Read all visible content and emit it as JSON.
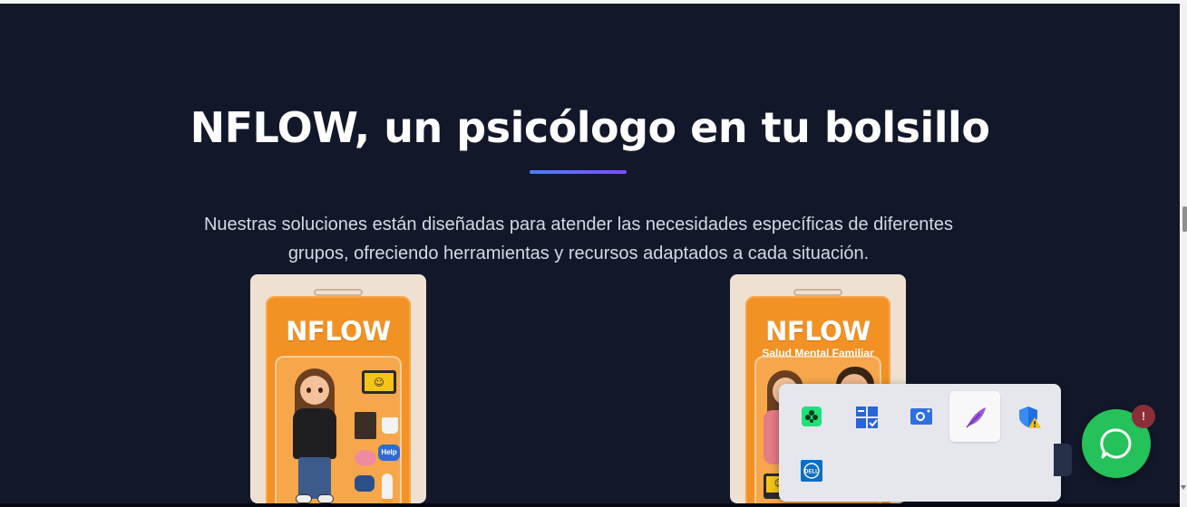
{
  "hero": {
    "title": "NFLOW, un psicólogo en tu bolsillo",
    "subtitle": "Nuestras soluciones están diseñadas para atender las necesidades específicas de diferentes grupos, ofreciendo herramientas y recursos adaptados a cada situación."
  },
  "cards": [
    {
      "brand": "NFLOW",
      "subtitle": "",
      "help_label": "Help"
    },
    {
      "brand": "NFLOW",
      "subtitle": "Salud Mental Familiar"
    }
  ],
  "tray": {
    "items": [
      {
        "icon": "green-game-icon"
      },
      {
        "icon": "task-grid-icon"
      },
      {
        "icon": "camera-icon"
      },
      {
        "icon": "feather-icon"
      },
      {
        "icon": "security-shield-warning-icon"
      },
      {
        "icon": "dell-icon"
      }
    ]
  },
  "whatsapp": {
    "badge": "!"
  },
  "colors": {
    "hero_bg": "#121829",
    "accent_start": "#4d7cff",
    "accent_end": "#7c4dff",
    "card_bg": "#efe1d1",
    "pack_orange": "#f29124",
    "whatsapp_green": "#25c15a"
  }
}
